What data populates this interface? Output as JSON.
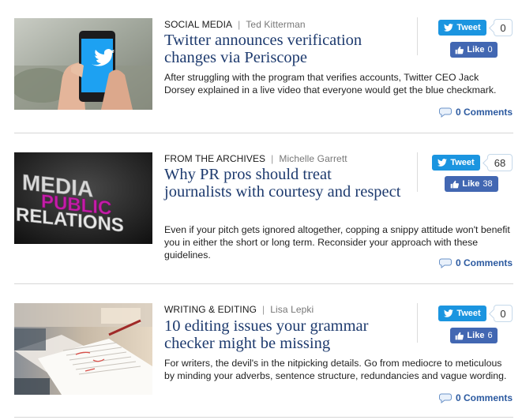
{
  "articles": [
    {
      "category": "SOCIAL MEDIA",
      "author": "Ted Kitterman",
      "title": "Twitter announces verification changes via Periscope",
      "excerpt": "After struggling with the program that verifies accounts, Twitter CEO Jack Dorsey explained in a live video that everyone would get the blue checkmark.",
      "tweet_label": "Tweet",
      "tweet_count": "0",
      "like_label": "Like",
      "like_count": "0",
      "comments": "0 Comments",
      "thumb_icon": "phone-twitter-image"
    },
    {
      "category": "FROM THE ARCHIVES",
      "author": "Michelle Garrett",
      "title": "Why PR pros should treat journalists with courtesy and respect",
      "excerpt": "Even if your pitch gets ignored altogether, copping a snippy attitude won't benefit you in either the short or long term. Reconsider your approach with these guidelines.",
      "tweet_label": "Tweet",
      "tweet_count": "68",
      "like_label": "Like",
      "like_count": "38",
      "comments": "0 Comments",
      "thumb_icon": "media-public-relations-image",
      "thumb_words": [
        "MEDIA",
        "PUBLIC",
        "RELATIONS"
      ]
    },
    {
      "category": "WRITING & EDITING",
      "author": "Lisa Lepki",
      "title": "10 editing issues your grammar checker might be missing",
      "excerpt": "For writers, the devil's in the nitpicking details. Go from mediocre to meticulous by minding your adverbs, sentence structure, redundancies and vague wording.",
      "tweet_label": "Tweet",
      "tweet_count": "0",
      "like_label": "Like",
      "like_count": "6",
      "comments": "0 Comments",
      "thumb_icon": "editing-desk-image"
    }
  ],
  "colors": {
    "title": "#1d3a6e",
    "tweet": "#1b95e0",
    "like": "#4267b2",
    "comments": "#2c5aa0"
  },
  "separator": "|"
}
